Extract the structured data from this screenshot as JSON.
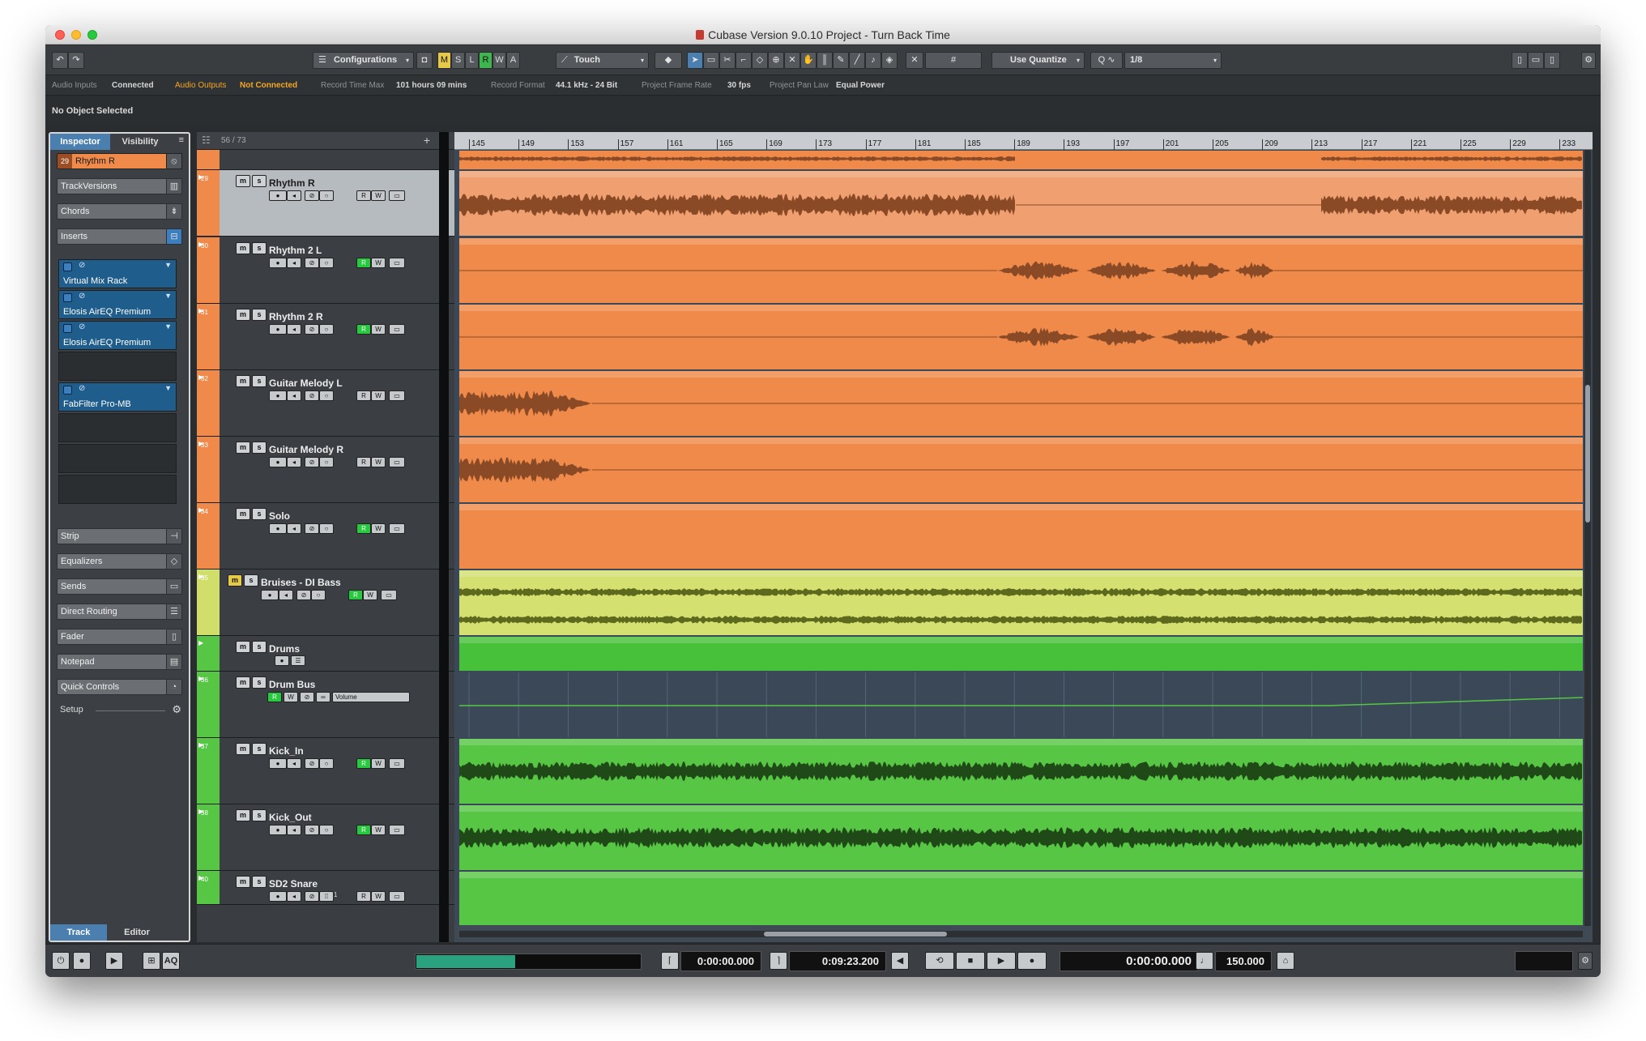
{
  "window": {
    "title": "Cubase Version 9.0.10 Project - Turn Back Time"
  },
  "toolbar": {
    "configurations_label": "Configurations",
    "mode_buttons": [
      "M",
      "S",
      "L",
      "R",
      "W",
      "A"
    ],
    "automation_mode": "Touch",
    "quantize_label": "Use Quantize",
    "quantize_value": "1/8"
  },
  "infoline": {
    "audio_inputs_label": "Audio Inputs",
    "audio_inputs_value": "Connected",
    "audio_outputs_label": "Audio Outputs",
    "audio_outputs_value": "Not Connected",
    "record_time_label": "Record Time Max",
    "record_time_value": "101 hours 09 mins",
    "record_format_label": "Record Format",
    "record_format_value": "44.1 kHz - 24 Bit",
    "frame_rate_label": "Project Frame Rate",
    "frame_rate_value": "30 fps",
    "pan_law_label": "Project Pan Law",
    "pan_law_value": "Equal Power"
  },
  "object_selection": "No Object Selected",
  "inspector": {
    "tabs": [
      "Inspector",
      "Visibility"
    ],
    "bottom_tabs": [
      "Track",
      "Editor"
    ],
    "track_number": "29",
    "track_name": "Rhythm R",
    "sections_top": [
      "TrackVersions",
      "Chords",
      "Inserts"
    ],
    "inserts": [
      "Virtual Mix Rack",
      "Elosis AirEQ Premium",
      "Elosis AirEQ Premium",
      "",
      "FabFilter Pro-MB"
    ],
    "sections_bottom": [
      "Strip",
      "Equalizers",
      "Sends",
      "Direct Routing",
      "Fader",
      "Notepad",
      "Quick Controls"
    ],
    "setup_label": "Setup"
  },
  "tracklist": {
    "count": "56 / 73",
    "tracks": [
      {
        "num": "29",
        "name": "Rhythm R",
        "rec_on": false
      },
      {
        "num": "30",
        "name": "Rhythm 2 L",
        "rec_on": true
      },
      {
        "num": "31",
        "name": "Rhythm 2 R",
        "rec_on": true
      },
      {
        "num": "32",
        "name": "Guitar Melody L",
        "rec_on": false
      },
      {
        "num": "33",
        "name": "Guitar Melody R",
        "rec_on": false
      },
      {
        "num": "34",
        "name": "Solo",
        "rec_on": true
      },
      {
        "num": "35",
        "name": "Bruises - DI Bass",
        "rec_on": true
      },
      {
        "num": "",
        "name": "Drums",
        "rec_on": false
      },
      {
        "num": "36",
        "name": "Drum Bus",
        "rec_on": false
      },
      {
        "num": "37",
        "name": "Kick_In",
        "rec_on": true
      },
      {
        "num": "38",
        "name": "Kick_Out",
        "rec_on": true
      },
      {
        "num": "40",
        "name": "SD2 Snare",
        "rec_on": false
      }
    ],
    "automation_param": "Volume",
    "trk_40_param": "1"
  },
  "ruler": {
    "bars": [
      "145",
      "149",
      "153",
      "157",
      "161",
      "165",
      "169",
      "173",
      "177",
      "181",
      "185",
      "189",
      "193",
      "197",
      "201",
      "205",
      "209",
      "213",
      "217",
      "221",
      "225",
      "229",
      "233"
    ]
  },
  "transport": {
    "left_locator": "0:00:00.000",
    "right_locator": "0:09:23.200",
    "position": "0:00:00.000",
    "tempo": "150.000",
    "aq_label": "AQ"
  },
  "colors": {
    "orange_track": "#ef8a4a",
    "bass_track": "#d1de6a",
    "drum_track": "#57c645",
    "record_green": "#27c93f",
    "accent_orange": "#f5a623"
  }
}
